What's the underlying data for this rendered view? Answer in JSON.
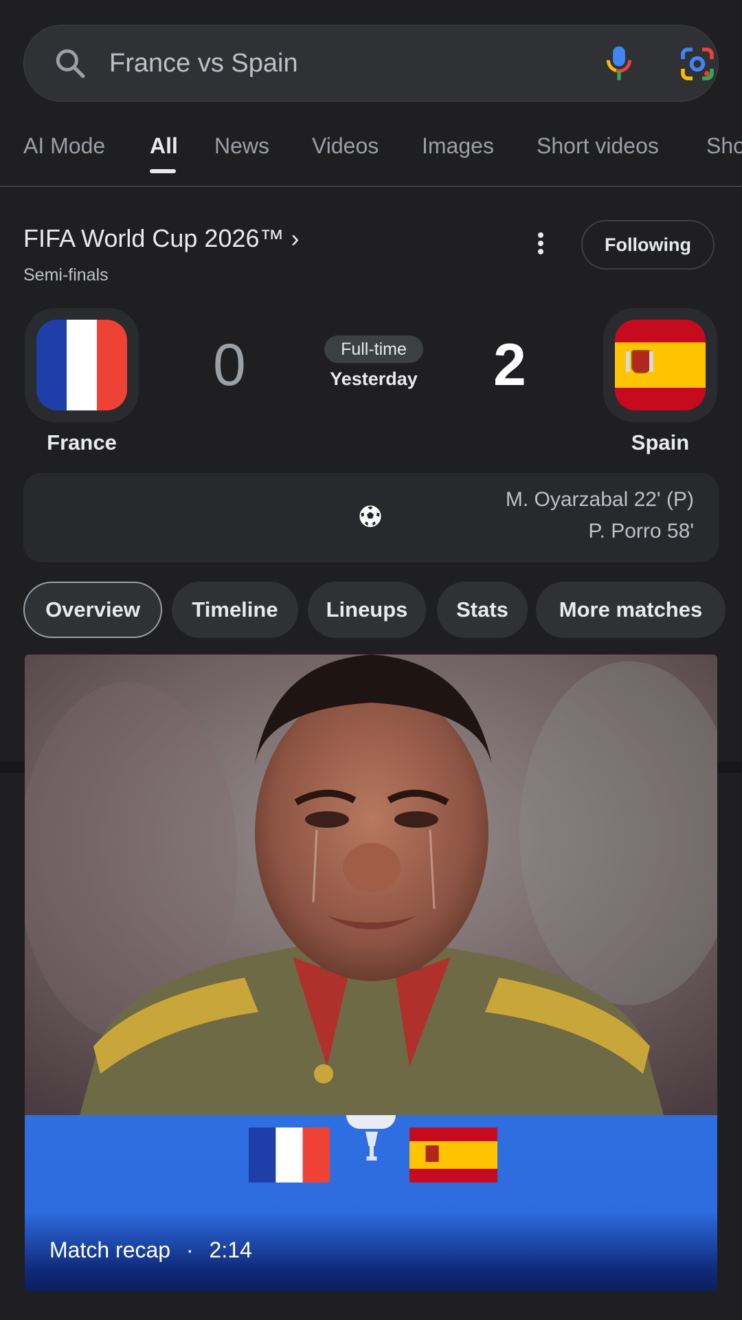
{
  "search": {
    "query": "France vs Spain"
  },
  "tabs": [
    {
      "label": "AI Mode"
    },
    {
      "label": "All"
    },
    {
      "label": "News"
    },
    {
      "label": "Videos"
    },
    {
      "label": "Images"
    },
    {
      "label": "Short videos"
    },
    {
      "label": "Sho"
    }
  ],
  "match": {
    "competition": "FIFA World Cup 2026™ ›",
    "stage": "Semi-finals",
    "follow_label": "Following",
    "home": {
      "name": "France",
      "score": "0",
      "flag": "france-flag-icon"
    },
    "away": {
      "name": "Spain",
      "score": "2",
      "flag": "spain-flag-icon"
    },
    "status": "Full-time",
    "when": "Yesterday",
    "scorers": [
      "M. Oyarzabal 22' (P)",
      "P. Porro 58'"
    ]
  },
  "chips": [
    {
      "label": "Overview"
    },
    {
      "label": "Timeline"
    },
    {
      "label": "Lineups"
    },
    {
      "label": "Stats"
    },
    {
      "label": "More matches"
    }
  ],
  "video": {
    "recap_label": "Match recap",
    "separator": "·",
    "duration": "2:14"
  },
  "colors": {
    "background": "#1f1f21",
    "surface": "#303134",
    "france_blue": "#1e3fa8",
    "france_red": "#ef4135",
    "spain_red": "#c60b1e",
    "spain_yellow": "#ffc400",
    "banner_blue": "#2f6fe0"
  }
}
